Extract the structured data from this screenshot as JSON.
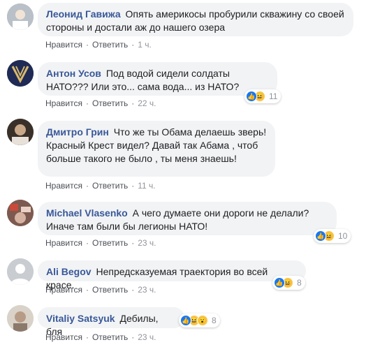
{
  "actions": {
    "like": "Нравится",
    "reply": "Ответить",
    "sep": "·"
  },
  "comments": [
    {
      "author": "Леонид Гавижа",
      "text": "Опять америкосы пробурили скважину со своей стороны и достали аж до нашего озера",
      "time": "1 ч."
    },
    {
      "author": "Антон Усов",
      "text": "Под водой сидели солдаты НАТО??? Или это... сама вода... из НАТО?",
      "time": "22 ч.",
      "reactions": "11"
    },
    {
      "author": "Дмитро Грин",
      "text": "Что же ты Обама делаешь зверь! Красный Крест видел? Давай так Абама , чтоб больше такого не было , ты меня знаешь!",
      "time": "11 ч."
    },
    {
      "author": "Michael Vlasenko",
      "text": "А чего думаете они дороги не делали? Иначе там были бы легионы НАТО!",
      "time": "23 ч.",
      "reactions": "10"
    },
    {
      "author": "Ali Begov",
      "text": "Непредсказуемая траектория во всей красе.",
      "time": "23 ч.",
      "reactions": "8"
    },
    {
      "author": "Vitaliy Satsyuk",
      "text": "Дебилы, бля",
      "time": "23 ч.",
      "reactions": "8"
    }
  ],
  "colors": {
    "author": "#385898",
    "bubble": "#f2f3f5",
    "like": "#1877f2",
    "haha": "#f7c54a"
  }
}
